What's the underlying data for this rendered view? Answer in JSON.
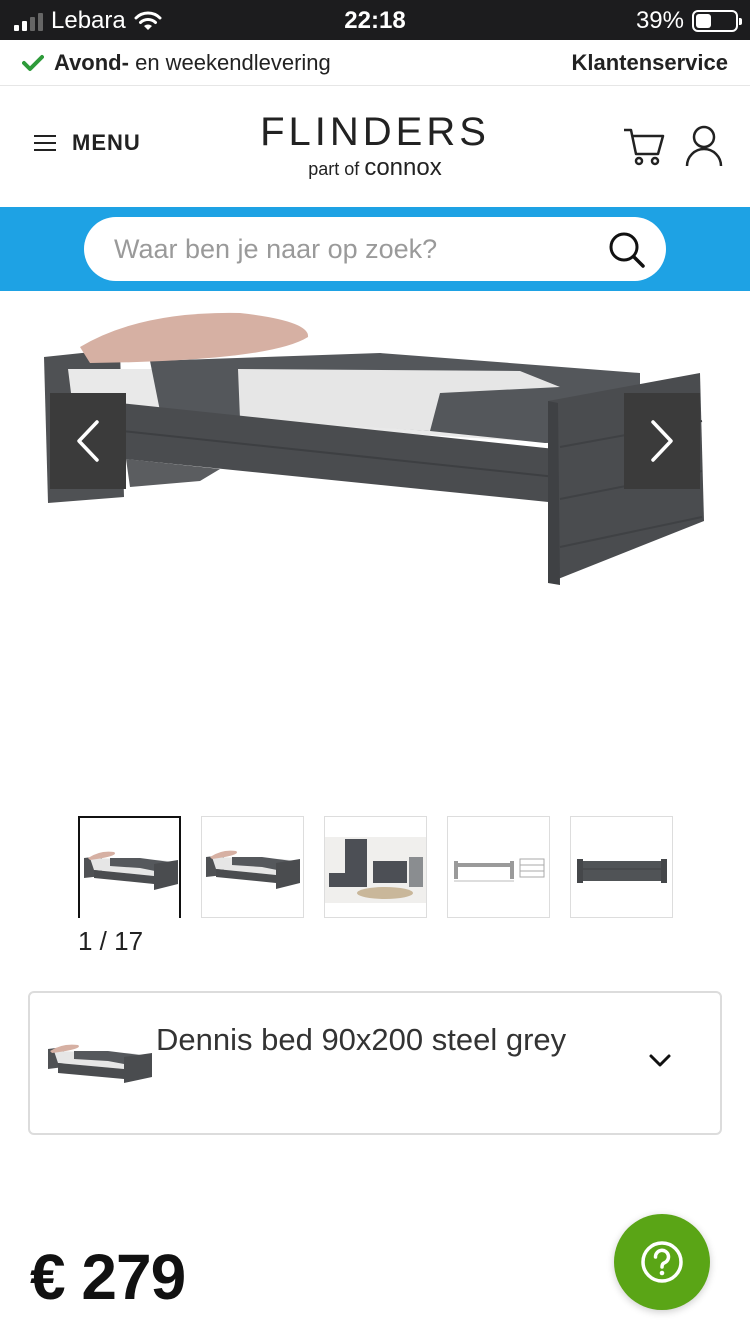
{
  "status_bar": {
    "carrier": "Lebara",
    "time": "22:18",
    "battery_percent": "39%",
    "battery_level": 0.39
  },
  "promo_bar": {
    "delivery_bold": "Avond-",
    "delivery_rest": "en weekendlevering",
    "customer_service": "Klantenservice"
  },
  "header": {
    "menu_label": "MENU",
    "logo_brand": "FLINDERS",
    "logo_part_of": "part of",
    "logo_connox": "connox",
    "cart_icon": "cart-icon",
    "account_icon": "user-icon"
  },
  "search": {
    "placeholder": "Waar ben je naar op zoek?",
    "value": ""
  },
  "gallery": {
    "counter": "1 / 17",
    "thumbnail_count": 5,
    "active_index": 0
  },
  "product": {
    "variant_name": "Dennis bed 90x200 steel grey",
    "price": "€ 279"
  },
  "colors": {
    "search_band": "#1ea2e4",
    "help_button": "#5aa516",
    "check": "#2e9b3a",
    "bed_frame": "#4a4c4f"
  }
}
